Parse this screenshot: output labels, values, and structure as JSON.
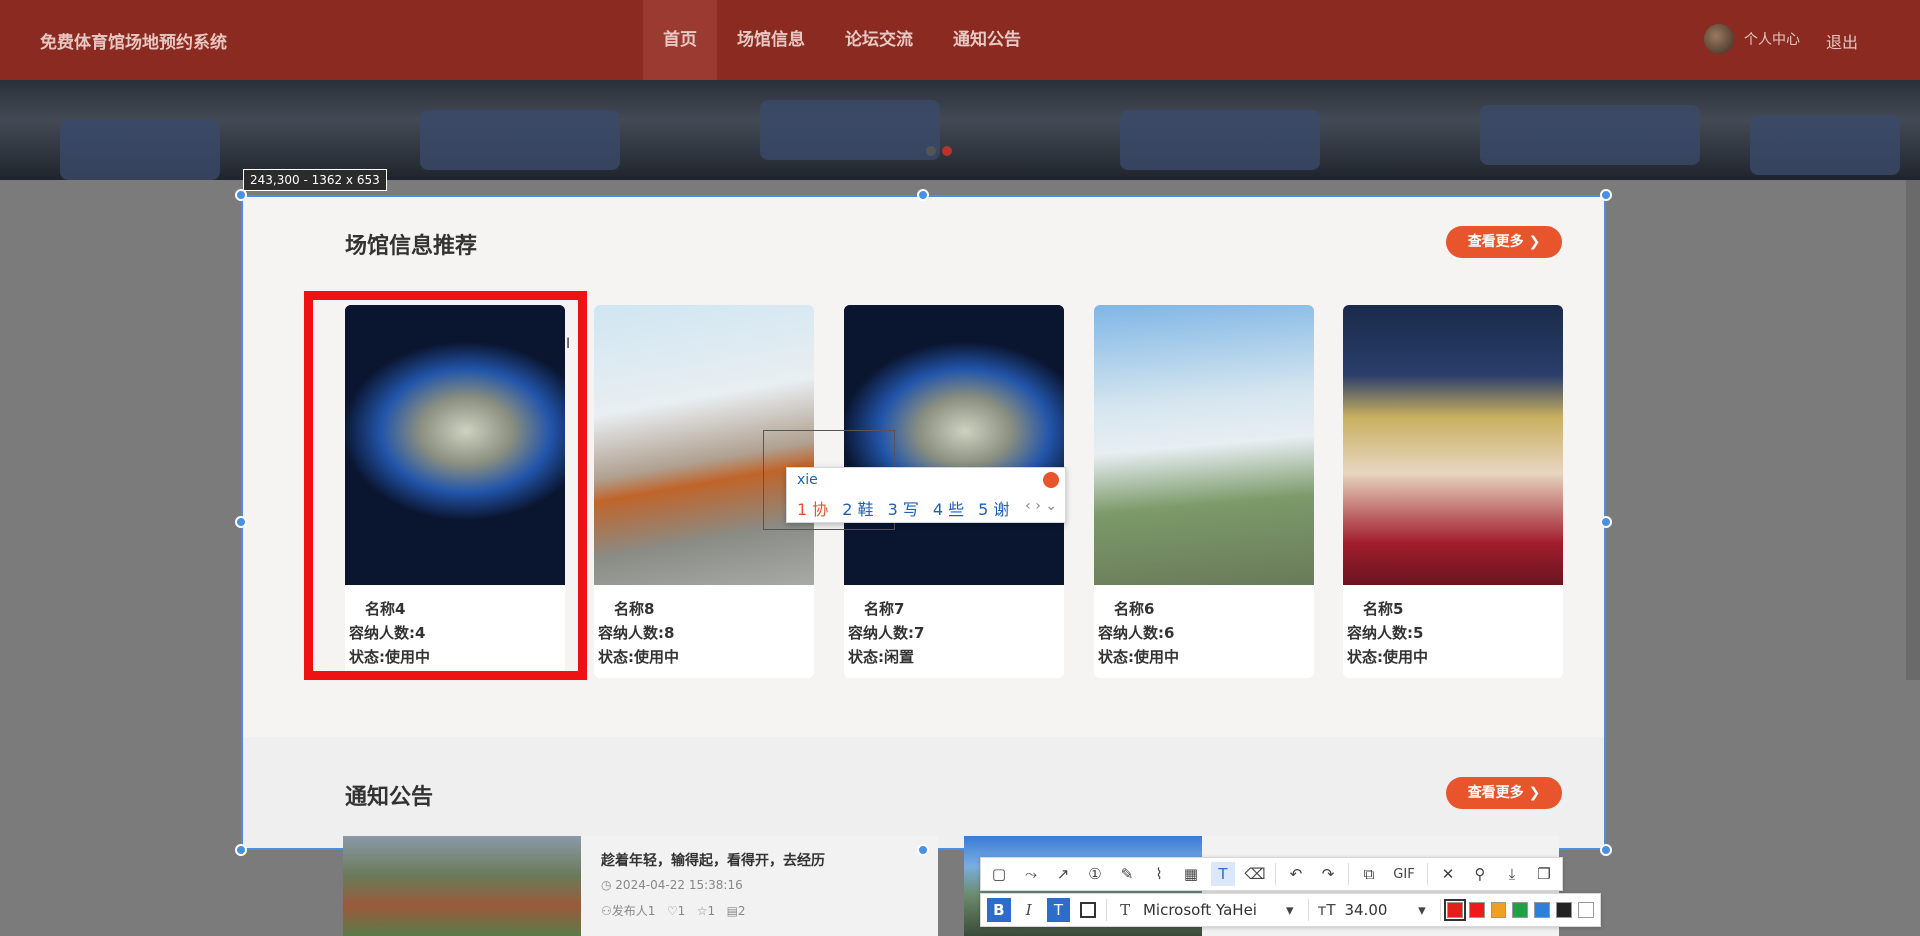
{
  "site": {
    "brand": "免费体育馆场地预约系统"
  },
  "nav": {
    "items": [
      "首页",
      "场馆信息",
      "论坛交流",
      "通知公告"
    ],
    "active_index": 0
  },
  "user": {
    "center": "个人中心",
    "logout": "退出"
  },
  "carousel": {
    "dots": 2,
    "active": 1
  },
  "venues": {
    "title": "场馆信息推荐",
    "more": "查看更多",
    "cards": [
      {
        "name": "名称4",
        "capacity": "容纳人数:4",
        "status": "状态:使用中",
        "image": "night-stadium"
      },
      {
        "name": "名称8",
        "capacity": "容纳人数:8",
        "status": "状态:使用中",
        "image": "arena-exterior"
      },
      {
        "name": "名称7",
        "capacity": "容纳人数:7",
        "status": "状态:闲置",
        "image": "night-stadium"
      },
      {
        "name": "名称6",
        "capacity": "容纳人数:6",
        "status": "状态:使用中",
        "image": "bird-roof-stadium"
      },
      {
        "name": "名称5",
        "capacity": "容纳人数:5",
        "status": "状态:使用中",
        "image": "indoor-court"
      }
    ]
  },
  "notices": {
    "title": "通知公告",
    "more": "查看更多",
    "items": [
      {
        "title": "趁着年轻，输得起，看得开，去经历",
        "date": "2024-04-22 15:38:16",
        "author": "发布人1",
        "likes": "1",
        "stars": "1",
        "comments": "2"
      }
    ]
  },
  "selection": {
    "size_label": "243,300 - 1362 x 653"
  },
  "ime": {
    "input": "xie",
    "candidates": [
      "1 协",
      "2 鞋",
      "3 写",
      "4 些",
      "5 谢"
    ]
  },
  "toolbar": {
    "tools_row1": [
      "rectangle-icon",
      "polyline-icon",
      "arrow-icon",
      "number-icon",
      "pen-icon",
      "marker-icon",
      "mosaic-icon",
      "text-icon",
      "eraser-icon",
      "undo-icon",
      "redo-icon",
      "ocr-icon",
      "gif",
      "close-icon",
      "pin-icon",
      "download-icon",
      "copy-icon"
    ],
    "gif_label": "GIF",
    "font_name": "Microsoft YaHei",
    "font_size": "34.00",
    "colors": [
      "#e0201a",
      "#ee1a1a",
      "#f0a020",
      "#22a045",
      "#2d7fdc",
      "#222222",
      "#ffffff"
    ]
  }
}
